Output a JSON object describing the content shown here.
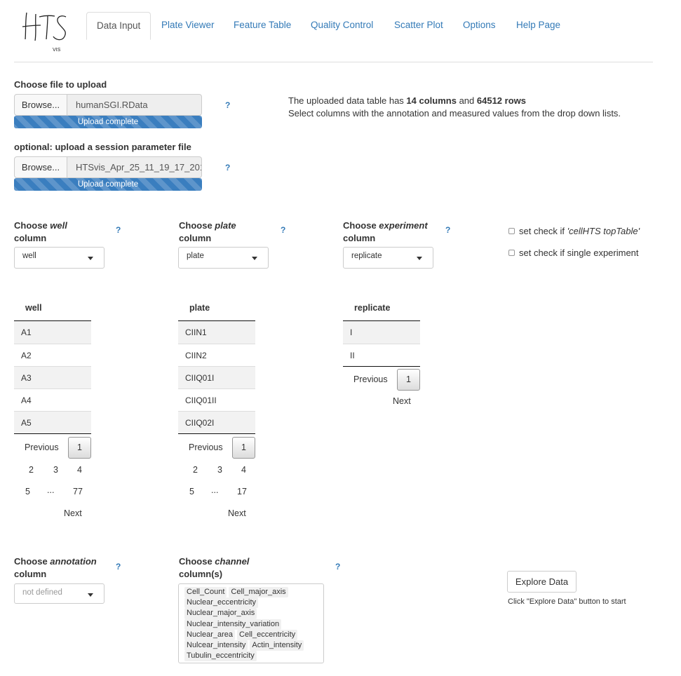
{
  "logo": {
    "main_text": "HTS",
    "sub_text": "VIS"
  },
  "nav": {
    "tabs": [
      {
        "label": "Data Input",
        "active": true
      },
      {
        "label": "Plate Viewer",
        "active": false
      },
      {
        "label": "Feature Table",
        "active": false
      },
      {
        "label": "Quality Control",
        "active": false
      },
      {
        "label": "Scatter Plot",
        "active": false
      },
      {
        "label": "Options",
        "active": false
      },
      {
        "label": "Help Page",
        "active": false
      }
    ]
  },
  "upload": {
    "label": "Choose file to upload",
    "browse_label": "Browse...",
    "file_name": "humanSGI.RData",
    "progress_label": "Upload complete",
    "progress_fraction": 1.0,
    "help": "?"
  },
  "session_upload": {
    "label": "optional: upload a session parameter file",
    "browse_label": "Browse...",
    "file_name": "HTSvis_Apr_25_11_19_17_201",
    "progress_label": "Upload complete",
    "progress_fraction": 1.0,
    "help": "?"
  },
  "info": {
    "line1_prefix": "The uploaded data table has ",
    "columns": "14 columns",
    "line1_mid": " and ",
    "rows": "64512 rows",
    "line2": "Select columns with the annotation and measured values from the drop down lists."
  },
  "selectors": {
    "well": {
      "label_prefix": "Choose ",
      "label_em": "well",
      "label_suffix": "column",
      "value": "well",
      "help": "?"
    },
    "plate": {
      "label_prefix": "Choose ",
      "label_em": "plate",
      "label_suffix": "column",
      "value": "plate",
      "help": "?"
    },
    "experiment": {
      "label_prefix": "Choose ",
      "label_em": "experiment",
      "label_suffix": "column",
      "value": "replicate",
      "help": "?"
    }
  },
  "checkboxes": {
    "toptable_prefix": "set check if ",
    "toptable_em": "'cellHTS topTable'",
    "single": "set check if single experiment",
    "toptable_checked": false,
    "single_checked": false
  },
  "tables": {
    "well": {
      "header": "well",
      "rows": [
        "A1",
        "A2",
        "A3",
        "A4",
        "A5"
      ],
      "pager": {
        "previous": "Previous",
        "current": "1",
        "pages_row1": [
          "2",
          "3",
          "4"
        ],
        "pages_row2": [
          "5",
          "...",
          "77"
        ],
        "next": "Next"
      }
    },
    "plate": {
      "header": "plate",
      "rows": [
        "CIIN1",
        "CIIN2",
        "CIIQ01I",
        "CIIQ01II",
        "CIIQ02I"
      ],
      "pager": {
        "previous": "Previous",
        "current": "1",
        "pages_row1": [
          "2",
          "3",
          "4"
        ],
        "pages_row2": [
          "5",
          "...",
          "17"
        ],
        "next": "Next"
      }
    },
    "replicate": {
      "header": "replicate",
      "rows": [
        "I",
        "II"
      ],
      "pager": {
        "previous": "Previous",
        "current": "1",
        "next": "Next"
      }
    }
  },
  "annotation": {
    "label_prefix": "Choose ",
    "label_em": "annotation",
    "label_suffix": "column",
    "value": "not defined",
    "help": "?"
  },
  "channel": {
    "label_prefix": "Choose ",
    "label_em": "channel",
    "label_suffix": "column(s)",
    "help": "?",
    "selected": [
      "Cell_Count",
      "Cell_major_axis",
      "Nuclear_eccentricity",
      "Nuclear_major_axis",
      "Nuclear_intensity_variation",
      "Nuclear_area",
      "Cell_eccentricity",
      "Nulcear_intensity",
      "Actin_intensity",
      "Tubulin_eccentricity"
    ]
  },
  "explore": {
    "button_label": "Explore Data",
    "note": "Click \"Explore Data\" button to start"
  },
  "colors": {
    "link": "#337ab7",
    "progress": "#3a7ebf",
    "border": "#cccccc"
  }
}
